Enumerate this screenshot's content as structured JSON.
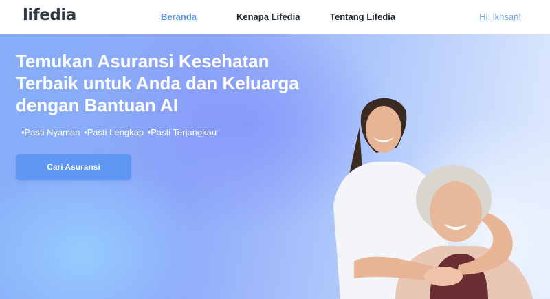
{
  "brand": {
    "logo_text": "lifedia"
  },
  "nav": {
    "links": [
      {
        "label": "Beranda",
        "active": true
      },
      {
        "label": "Kenapa Lifedia",
        "active": false
      },
      {
        "label": "Tentang Lifedia",
        "active": false
      }
    ],
    "user_greeting": "Hi, ikhsan!"
  },
  "hero": {
    "title_lines": [
      "Temukan Asuransi Kesehatan",
      "Terbaik untuk Anda dan Keluarga",
      "dengan Bantuan AI"
    ],
    "features": [
      "•Pasti Nyaman",
      "•Pasti Lengkap",
      "•Pasti Terjangkau"
    ],
    "cta_label": "Cari Asuransi"
  },
  "colors": {
    "accent": "#5f97f4",
    "nav_active": "#5b8fe8",
    "hero_gradient_start": "#86aef8",
    "hero_gradient_end": "#e2ecfd"
  }
}
